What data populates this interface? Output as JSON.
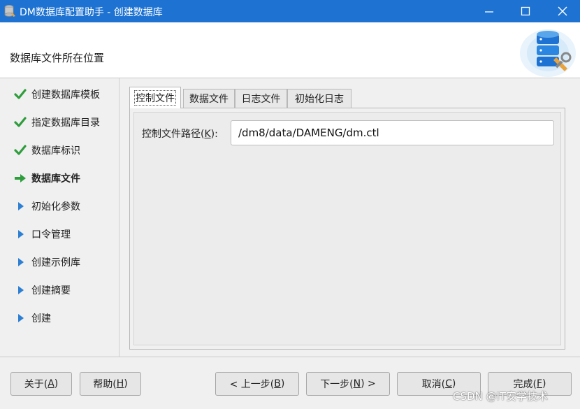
{
  "window": {
    "title": "DM数据库配置助手 - 创建数据库",
    "controls": {
      "minimize": "minimize-icon",
      "maximize": "maximize-icon",
      "close": "close-icon"
    }
  },
  "header": {
    "page_title": "数据库文件所在位置",
    "art_icon": "database-settings-icon"
  },
  "steps": [
    {
      "label": "创建数据库模板",
      "status": "done",
      "icon": "check-icon"
    },
    {
      "label": "指定数据库目录",
      "status": "done",
      "icon": "check-icon"
    },
    {
      "label": "数据库标识",
      "status": "done",
      "icon": "check-icon"
    },
    {
      "label": "数据库文件",
      "status": "current",
      "icon": "arrow-right-icon"
    },
    {
      "label": "初始化参数",
      "status": "pending",
      "icon": "triangle-right-icon"
    },
    {
      "label": "口令管理",
      "status": "pending",
      "icon": "triangle-right-icon"
    },
    {
      "label": "创建示例库",
      "status": "pending",
      "icon": "triangle-right-icon"
    },
    {
      "label": "创建摘要",
      "status": "pending",
      "icon": "triangle-right-icon"
    },
    {
      "label": "创建",
      "status": "pending",
      "icon": "triangle-right-icon"
    }
  ],
  "tabs": [
    {
      "label": "控制文件",
      "active": true
    },
    {
      "label": "数据文件",
      "active": false
    },
    {
      "label": "日志文件",
      "active": false
    },
    {
      "label": "初始化日志",
      "active": false
    }
  ],
  "control_file": {
    "label_prefix": "控制文件路径(",
    "label_key": "K",
    "label_suffix": "):",
    "path": "/dm8/data/DAMENG/dm.ctl"
  },
  "buttons": {
    "about": {
      "pre": "关于(",
      "key": "A",
      "post": ")"
    },
    "help": {
      "pre": "帮助(",
      "key": "H",
      "post": ")"
    },
    "back": {
      "pre": "< 上一步(",
      "key": "B",
      "post": ")"
    },
    "next": {
      "pre": "下一步(",
      "key": "N",
      "post": ") >"
    },
    "cancel": {
      "pre": "取消(",
      "key": "C",
      "post": ")"
    },
    "finish": {
      "pre": "完成(",
      "key": "F",
      "post": ")"
    }
  },
  "watermark": "CSDN @IT安学技术",
  "colors": {
    "titlebar": "#1e73d2",
    "check": "#2e9d3c",
    "arrow": "#2e9d3c",
    "triangle": "#2d7fd3"
  }
}
